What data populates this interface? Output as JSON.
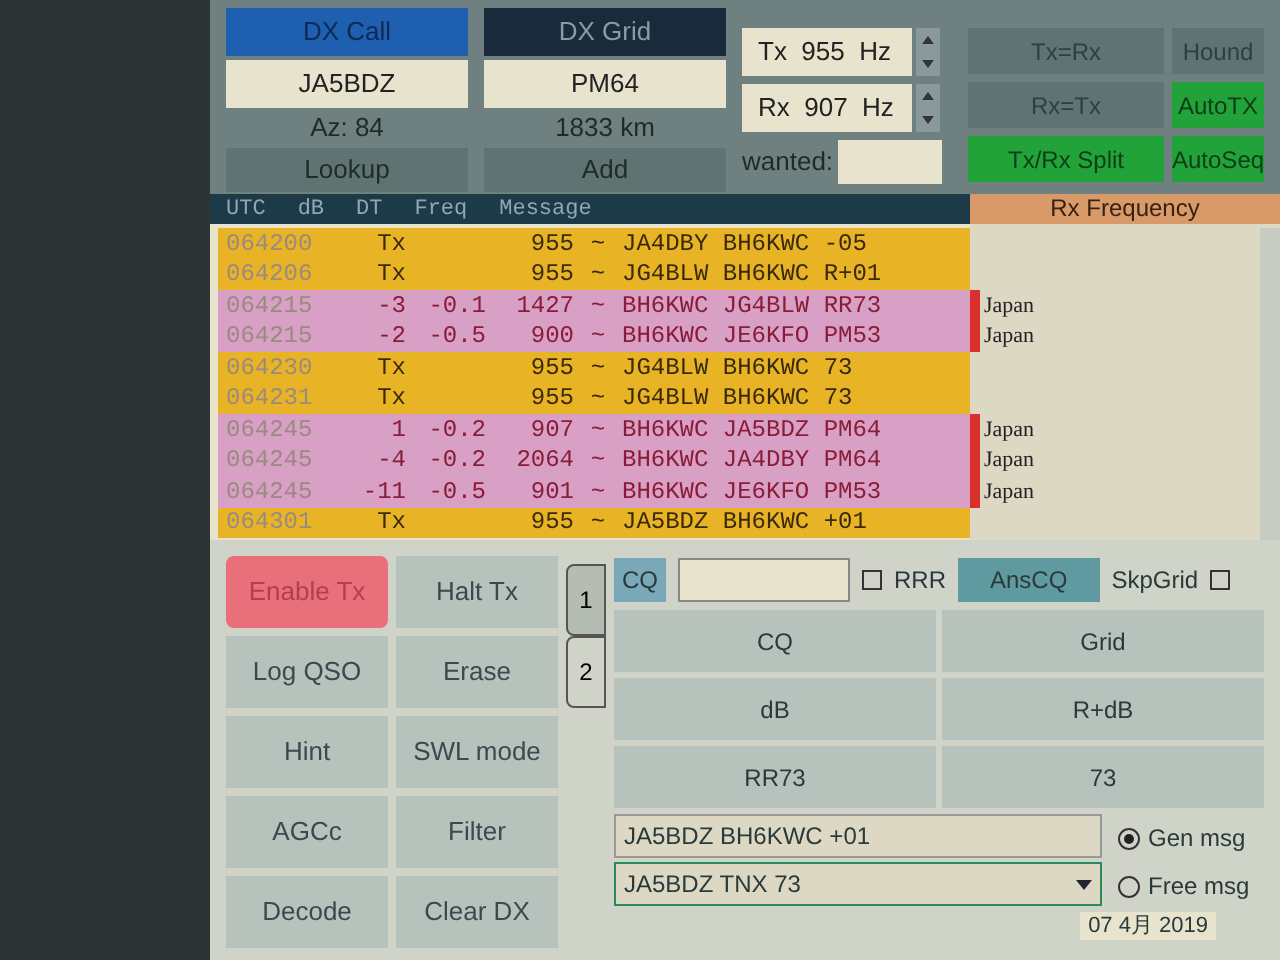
{
  "dx": {
    "call_label": "DX Call",
    "grid_label": "DX Grid",
    "call": "JA5BDZ",
    "grid": "PM64",
    "azimuth": "Az: 84",
    "distance": "1833 km",
    "buttons": [
      "Lookup",
      "Add"
    ]
  },
  "freq": {
    "tx": "Tx  955  Hz",
    "rx": "Rx  907  Hz",
    "wanted_label": "wanted:"
  },
  "top_buttons": [
    {
      "label": "Tx=Rx",
      "on": false
    },
    {
      "label": "Hound",
      "on": false
    },
    {
      "label": "Rx=Tx",
      "on": false
    },
    {
      "label": "AutoTX",
      "on": true
    },
    {
      "label": "Tx/Rx Split",
      "on": true
    },
    {
      "label": "AutoSeq",
      "on": true
    }
  ],
  "table": {
    "columns": [
      "UTC",
      "dB",
      "DT",
      "Freq",
      "Message"
    ],
    "rx_title": "Rx Frequency",
    "rows": [
      {
        "kind": "tx",
        "utc": "064200",
        "db": "Tx",
        "freq": "955",
        "sep": "~",
        "message": "JA4DBY BH6KWC -05"
      },
      {
        "kind": "tx",
        "utc": "064206",
        "db": "Tx",
        "freq": "955",
        "sep": "~",
        "message": "JG4BLW BH6KWC R+01"
      },
      {
        "kind": "rx",
        "utc": "064215",
        "db": "-3",
        "dt": "-0.1",
        "freq": "1427",
        "sep": "~",
        "message": "BH6KWC JG4BLW RR73",
        "country": "Japan"
      },
      {
        "kind": "rx",
        "utc": "064215",
        "db": "-2",
        "dt": "-0.5",
        "freq": "900",
        "sep": "~",
        "message": "BH6KWC JE6KFO PM53",
        "country": "Japan"
      },
      {
        "kind": "tx",
        "utc": "064230",
        "db": "Tx",
        "freq": "955",
        "sep": "~",
        "message": "JG4BLW BH6KWC 73"
      },
      {
        "kind": "tx",
        "utc": "064231",
        "db": "Tx",
        "freq": "955",
        "sep": "~",
        "message": "JG4BLW BH6KWC 73"
      },
      {
        "kind": "rx",
        "utc": "064245",
        "db": "1",
        "dt": "-0.2",
        "freq": "907",
        "sep": "~",
        "message": "BH6KWC JA5BDZ PM64",
        "country": "Japan"
      },
      {
        "kind": "rx",
        "utc": "064245",
        "db": "-4",
        "dt": "-0.2",
        "freq": "2064",
        "sep": "~",
        "message": "BH6KWC JA4DBY PM64",
        "country": "Japan"
      },
      {
        "kind": "rx",
        "utc": "064245",
        "db": "-11",
        "dt": "-0.5",
        "freq": "901",
        "sep": "~",
        "message": "BH6KWC JE6KFO PM53",
        "country": "Japan"
      },
      {
        "kind": "tx",
        "utc": "064301",
        "db": "Tx",
        "freq": "955",
        "sep": "~",
        "message": "JA5BDZ BH6KWC +01"
      }
    ]
  },
  "controls": [
    {
      "label": "Enable Tx",
      "on": true
    },
    {
      "label": "Halt Tx",
      "on": false
    },
    {
      "label": "Log QSO",
      "on": false
    },
    {
      "label": "Erase",
      "on": false
    },
    {
      "label": "Hint",
      "on": false
    },
    {
      "label": "SWL mode",
      "on": false
    },
    {
      "label": "AGCc",
      "on": false
    },
    {
      "label": "Filter",
      "on": false
    },
    {
      "label": "Decode",
      "on": false
    },
    {
      "label": "Clear DX",
      "on": false
    }
  ],
  "tabs": [
    {
      "label": "1",
      "selected": false
    },
    {
      "label": "2",
      "selected": true
    }
  ],
  "cq_label": "CQ",
  "rrr": {
    "label": "RRR",
    "checked": false
  },
  "anscq": "AnsCQ",
  "skpgrid": {
    "label": "SkpGrid",
    "checked": false
  },
  "msg_buttons": [
    "CQ",
    "Grid",
    "dB",
    "R+dB",
    "RR73",
    "73"
  ],
  "gen_msg": "JA5BDZ BH6KWC +01",
  "free_msg": "JA5BDZ TNX 73",
  "radios": [
    {
      "label": "Gen msg",
      "selected": true
    },
    {
      "label": "Free msg",
      "selected": false
    }
  ],
  "date": "07 4月 2019"
}
